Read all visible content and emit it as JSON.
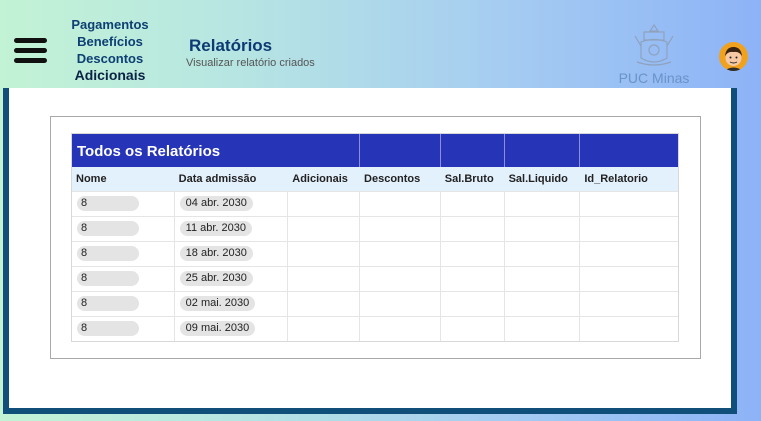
{
  "nav": {
    "items": [
      "Pagamentos",
      "Benefícios",
      "Descontos",
      "Adicionais"
    ]
  },
  "header": {
    "title": "Relatórios",
    "subtitle": "Visualizar relatório criados"
  },
  "logo": {
    "text": "PUC Minas",
    "icon": "puc-crest-icon"
  },
  "avatar": {
    "icon": "user-avatar-icon"
  },
  "table": {
    "title": "Todos os Relatórios",
    "columns": [
      "Nome",
      "Data admissão",
      "Adicionais",
      "Descontos",
      "Sal.Bruto",
      "Sal.Liquido",
      "Id_Relatorio"
    ],
    "rows": [
      {
        "nome": "8",
        "data": "04 abr. 2030"
      },
      {
        "nome": "8",
        "data": "11 abr. 2030"
      },
      {
        "nome": "8",
        "data": "18 abr. 2030"
      },
      {
        "nome": "8",
        "data": "25 abr. 2030"
      },
      {
        "nome": "8",
        "data": "02 mai. 2030"
      },
      {
        "nome": "8",
        "data": "09 mai. 2030"
      }
    ]
  },
  "colors": {
    "table_header": "#2634b8",
    "panel_border": "#0f4f7a",
    "nav_text": "#0d3f73"
  }
}
